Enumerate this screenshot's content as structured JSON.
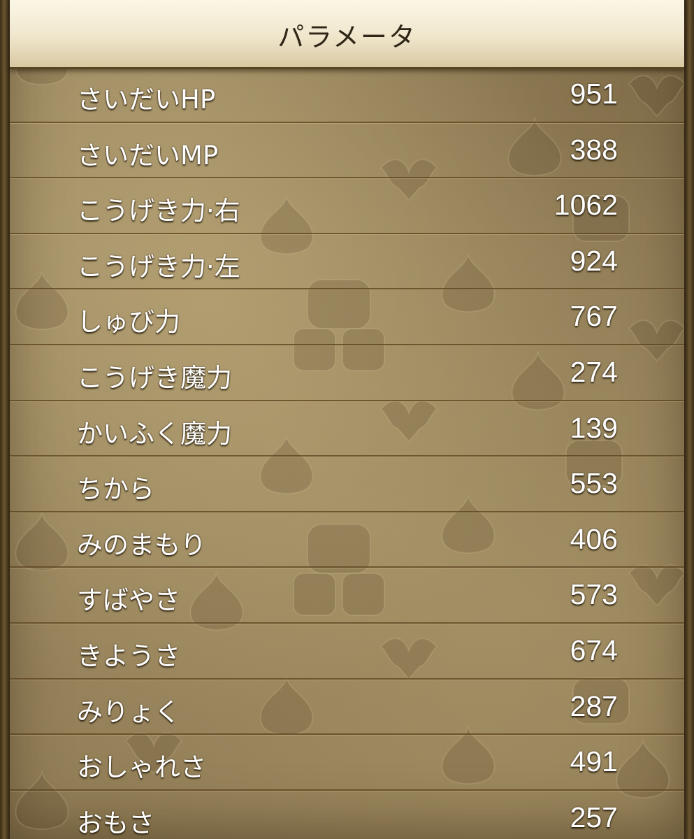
{
  "header": {
    "title": "パラメータ"
  },
  "parameters": [
    {
      "label": "さいだいHP",
      "value": "951"
    },
    {
      "label": "さいだいMP",
      "value": "388"
    },
    {
      "label": "こうげき力·右",
      "value": "1062"
    },
    {
      "label": "こうげき力·左",
      "value": "924"
    },
    {
      "label": "しゅび力",
      "value": "767"
    },
    {
      "label": "こうげき魔力",
      "value": "274"
    },
    {
      "label": "かいふく魔力",
      "value": "139"
    },
    {
      "label": "ちから",
      "value": "553"
    },
    {
      "label": "みのまもり",
      "value": "406"
    },
    {
      "label": "すばやさ",
      "value": "573"
    },
    {
      "label": "きようさ",
      "value": "674"
    },
    {
      "label": "みりょく",
      "value": "287"
    },
    {
      "label": "おしゃれさ",
      "value": "491"
    },
    {
      "label": "おもさ",
      "value": "257"
    }
  ],
  "background": {
    "motif_icons": [
      "slime-icon",
      "dracky-icon",
      "golem-icon"
    ]
  }
}
